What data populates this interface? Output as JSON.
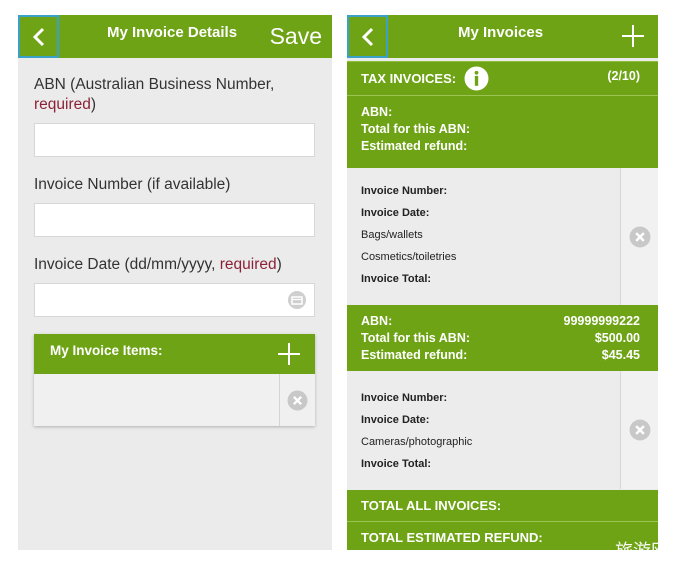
{
  "left_screen": {
    "header": {
      "title": "My Invoice Details",
      "save_label": "Save"
    },
    "abn": {
      "label": "ABN (Australian Business Number,",
      "required": "required",
      "suffix": ")",
      "value": ""
    },
    "invoice_number": {
      "label": "Invoice Number (if available)",
      "value": ""
    },
    "invoice_date": {
      "label": "Invoice Date (dd/mm/yyyy, ",
      "required": "required",
      "suffix": ")",
      "value": ""
    },
    "invoice_items": {
      "title": "My Invoice Items:"
    }
  },
  "right_screen": {
    "header": {
      "title": "My Invoices"
    },
    "tax_invoices": {
      "label": "TAX INVOICES:",
      "count": "(2/10)"
    },
    "groups": [
      {
        "abn_label": "ABN:",
        "abn_value": "",
        "total_label": "Total for this ABN:",
        "total_value": "",
        "refund_label": "Estimated refund:",
        "refund_value": "",
        "invoice": {
          "number_label": "Invoice Number:",
          "date_label": "Invoice Date:",
          "categories": [
            "Bags/wallets",
            "Cosmetics/toiletries"
          ],
          "total_label": "Invoice Total:"
        }
      },
      {
        "abn_label": "ABN:",
        "abn_value": "99999999222",
        "total_label": "Total for this ABN:",
        "total_value": "$500.00",
        "refund_label": "Estimated refund:",
        "refund_value": "$45.45",
        "invoice": {
          "number_label": "Invoice Number:",
          "date_label": "Invoice Date:",
          "categories": [
            "Cameras/photographic"
          ],
          "total_label": "Invoice Total:"
        }
      }
    ],
    "total_all_invoices": "TOTAL ALL INVOICES:",
    "total_estimated_refund": "TOTAL ESTIMATED REFUND:"
  },
  "watermark": "旅游网",
  "icons": {
    "back": "chevron-left-icon",
    "add": "plus-icon",
    "info": "info-icon",
    "delete": "close-circle-icon",
    "calendar": "calendar-icon"
  },
  "colors": {
    "accent_green": "#6ea315",
    "highlight_blue": "#3aa1c8",
    "required_red": "#8b2237"
  }
}
